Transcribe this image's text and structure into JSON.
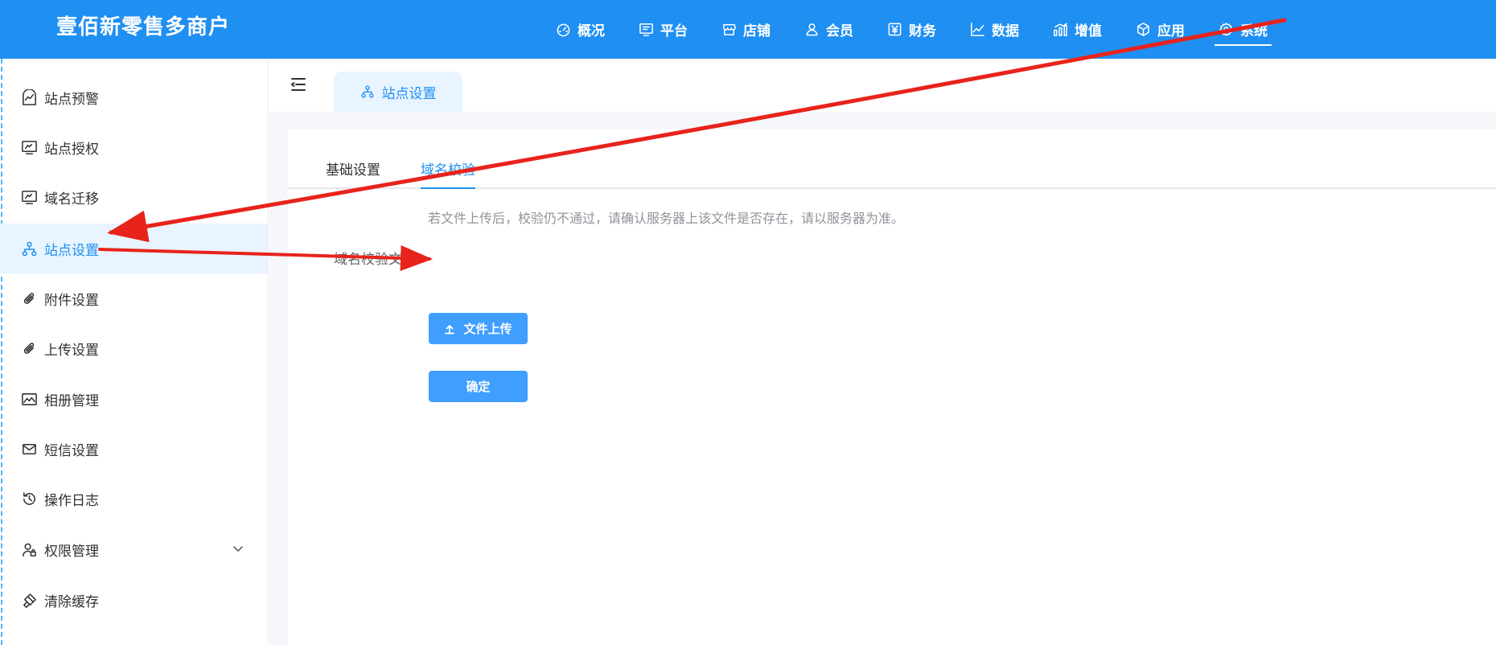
{
  "app": {
    "title": "壹佰新零售多商户"
  },
  "topnav": [
    {
      "label": "概况",
      "icon": "dashboard-icon"
    },
    {
      "label": "平台",
      "icon": "monitor-icon"
    },
    {
      "label": "店铺",
      "icon": "store-icon"
    },
    {
      "label": "会员",
      "icon": "user-icon"
    },
    {
      "label": "财务",
      "icon": "yen-icon"
    },
    {
      "label": "数据",
      "icon": "line-chart-icon"
    },
    {
      "label": "增值",
      "icon": "bar-chart-icon"
    },
    {
      "label": "应用",
      "icon": "box-icon"
    },
    {
      "label": "系统",
      "icon": "gear-icon",
      "active": true
    }
  ],
  "sidebar": {
    "items": [
      {
        "label": "站点预警",
        "icon": "warning-chart-icon"
      },
      {
        "label": "站点授权",
        "icon": "monitor-icon"
      },
      {
        "label": "域名迁移",
        "icon": "monitor-icon"
      },
      {
        "label": "站点设置",
        "icon": "sitemap-icon",
        "active": true
      },
      {
        "label": "附件设置",
        "icon": "paperclip-icon"
      },
      {
        "label": "上传设置",
        "icon": "paperclip-icon"
      },
      {
        "label": "相册管理",
        "icon": "image-icon"
      },
      {
        "label": "短信设置",
        "icon": "mail-icon"
      },
      {
        "label": "操作日志",
        "icon": "history-icon"
      },
      {
        "label": "权限管理",
        "icon": "user-lock-icon",
        "has_children": true
      },
      {
        "label": "清除缓存",
        "icon": "eraser-icon"
      }
    ]
  },
  "page_tab": {
    "label": "站点设置",
    "icon": "sitemap-icon"
  },
  "subtabs": [
    {
      "label": "基础设置"
    },
    {
      "label": "域名校验",
      "active": true
    }
  ],
  "form": {
    "hint": "若文件上传后，校验仍不通过，请确认服务器上该文件是否存在，请以服务器为准。",
    "file_label": "域名校验文件",
    "upload_label": "文件上传",
    "confirm_label": "确定"
  },
  "colors": {
    "primary": "#1f8ff2",
    "button": "#409eff",
    "annotation_arrow": "#e8231c"
  }
}
